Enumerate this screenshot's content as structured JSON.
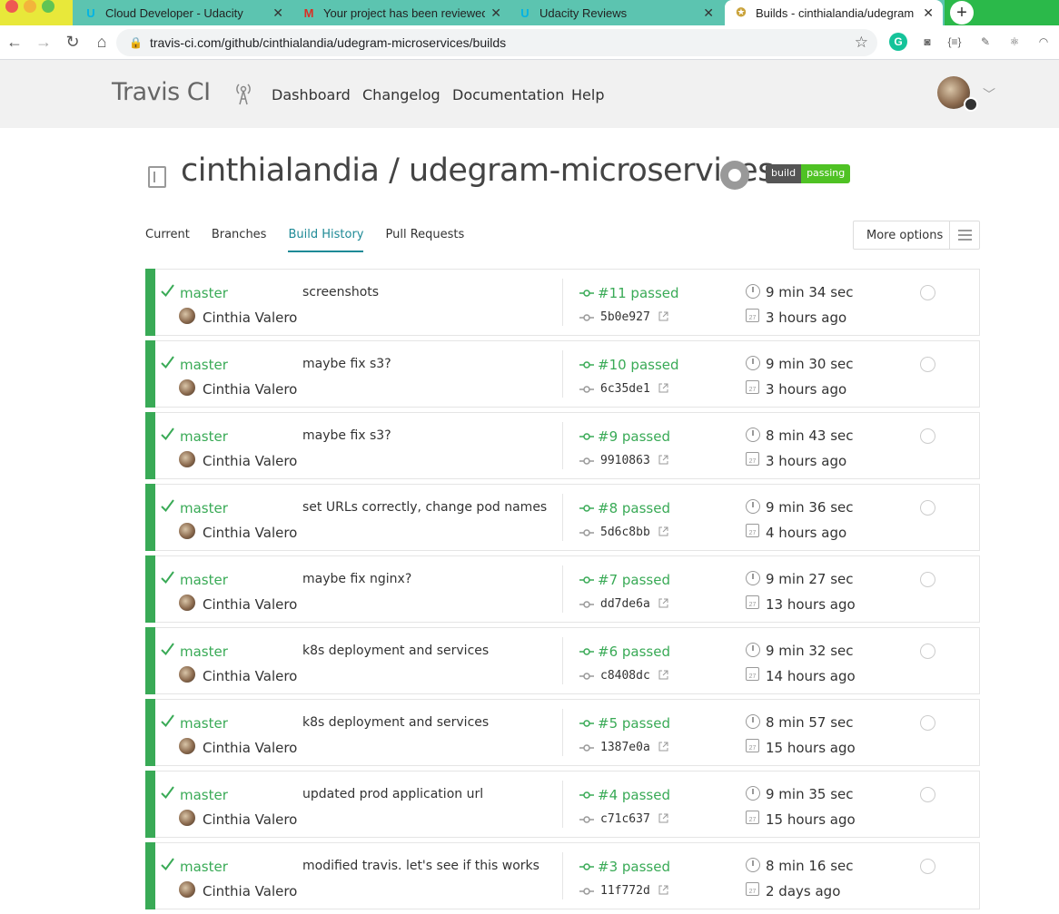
{
  "browser": {
    "tabs": [
      {
        "title": "Cloud Developer - Udacity",
        "favicon": "udacity-icon",
        "active": false
      },
      {
        "title": "Your project has been reviewed",
        "favicon": "gmail-icon",
        "active": false
      },
      {
        "title": "Udacity Reviews",
        "favicon": "udacity-icon",
        "active": false
      },
      {
        "title": "Builds - cinthialandia/udegram",
        "favicon": "travis-icon",
        "active": true
      }
    ],
    "url": "travis-ci.com/github/cinthialandia/udegram-microservices/builds"
  },
  "header": {
    "logo": "Travis CI",
    "nav": [
      "Dashboard",
      "Changelog",
      "Documentation",
      "Help"
    ]
  },
  "repo": {
    "title": "cinthialandia / udegram-microservices",
    "badge_left": "build",
    "badge_right": "passing"
  },
  "tabs": {
    "current": "Current",
    "branches": "Branches",
    "history": "Build History",
    "pulls": "Pull Requests",
    "more_options": "More options"
  },
  "builds": [
    {
      "branch": "master",
      "author": "Cinthia Valero",
      "message": "screenshots",
      "number": "#11 passed",
      "sha": "5b0e927",
      "duration": "9 min 34 sec",
      "ago": "3 hours ago"
    },
    {
      "branch": "master",
      "author": "Cinthia Valero",
      "message": "maybe fix s3?",
      "number": "#10 passed",
      "sha": "6c35de1",
      "duration": "9 min 30 sec",
      "ago": "3 hours ago"
    },
    {
      "branch": "master",
      "author": "Cinthia Valero",
      "message": "maybe fix s3?",
      "number": "#9 passed",
      "sha": "9910863",
      "duration": "8 min 43 sec",
      "ago": "3 hours ago"
    },
    {
      "branch": "master",
      "author": "Cinthia Valero",
      "message": "set URLs correctly, change pod names",
      "number": "#8 passed",
      "sha": "5d6c8bb",
      "duration": "9 min 36 sec",
      "ago": "4 hours ago"
    },
    {
      "branch": "master",
      "author": "Cinthia Valero",
      "message": "maybe fix nginx?",
      "number": "#7 passed",
      "sha": "dd7de6a",
      "duration": "9 min 27 sec",
      "ago": "13 hours ago"
    },
    {
      "branch": "master",
      "author": "Cinthia Valero",
      "message": "k8s deployment and services",
      "number": "#6 passed",
      "sha": "c8408dc",
      "duration": "9 min 32 sec",
      "ago": "14 hours ago"
    },
    {
      "branch": "master",
      "author": "Cinthia Valero",
      "message": "k8s deployment and services",
      "number": "#5 passed",
      "sha": "1387e0a",
      "duration": "8 min 57 sec",
      "ago": "15 hours ago"
    },
    {
      "branch": "master",
      "author": "Cinthia Valero",
      "message": "updated prod application url",
      "number": "#4 passed",
      "sha": "c71c637",
      "duration": "9 min 35 sec",
      "ago": "15 hours ago"
    },
    {
      "branch": "master",
      "author": "Cinthia Valero",
      "message": "modified travis. let's see if this works",
      "number": "#3 passed",
      "sha": "11f772d",
      "duration": "8 min 16 sec",
      "ago": "2 days ago"
    }
  ],
  "colors": {
    "passed": "#39aa56",
    "accent": "#1e8a96"
  }
}
